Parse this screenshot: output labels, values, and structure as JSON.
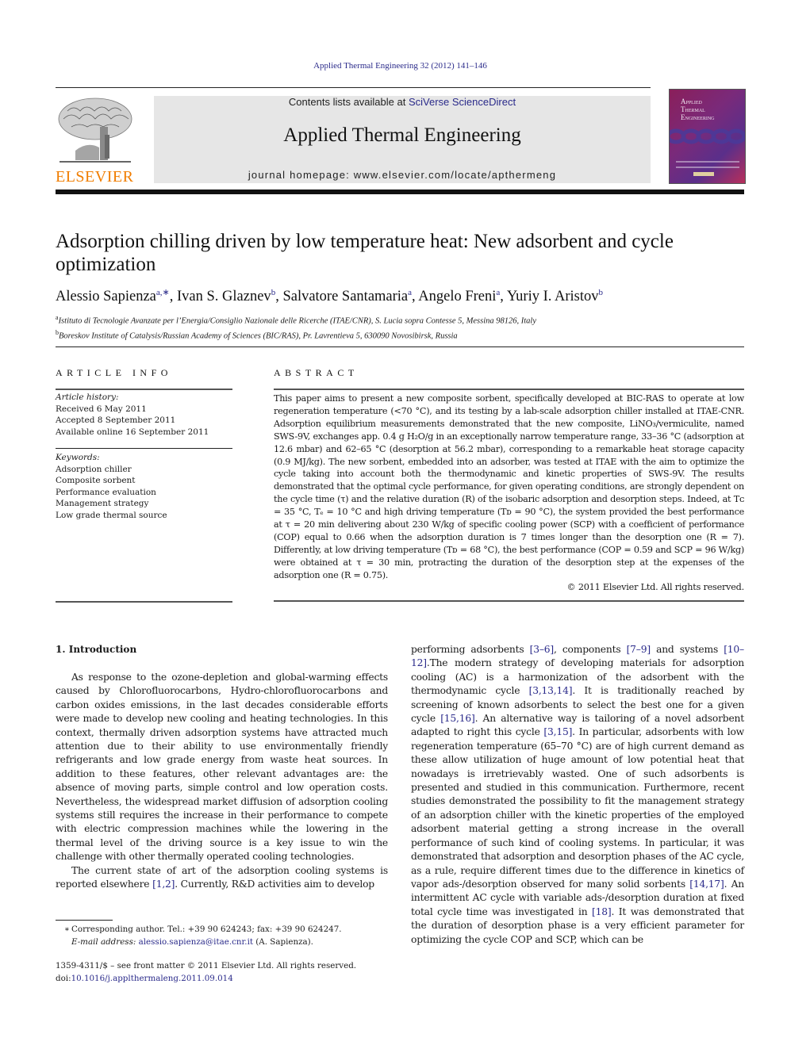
{
  "journal_ref": "Applied Thermal Engineering 32 (2012) 141–146",
  "header": {
    "contents_prefix": "Contents lists available at ",
    "contents_link": "SciVerse ScienceDirect",
    "journal_title": "Applied Thermal Engineering",
    "homepage": "journal homepage: www.elsevier.com/locate/apthermeng",
    "publisher_logo_text": "ELSEVIER",
    "cover_title_lines": [
      "Applied",
      "Thermal",
      "Engineering"
    ]
  },
  "colors": {
    "link": "#2a2a8a",
    "elsevier_orange": "#f07d00",
    "banner_bg": "#e6e6e6"
  },
  "article": {
    "title": "Adsorption chilling driven by low temperature heat: New adsorbent and cycle optimization",
    "authors": [
      {
        "name": "Alessio Sapienza",
        "sup": "a,∗",
        "sep": ", "
      },
      {
        "name": "Ivan S. Glaznev",
        "sup": "b",
        "sep": ", "
      },
      {
        "name": "Salvatore Santamaria",
        "sup": "a",
        "sep": ", "
      },
      {
        "name": "Angelo Freni",
        "sup": "a",
        "sep": ", "
      },
      {
        "name": "Yuriy I. Aristov",
        "sup": "b",
        "sep": ""
      }
    ],
    "affiliations": [
      {
        "key": "a",
        "text": "Istituto di Tecnologie Avanzate per l’Energia/Consiglio Nazionale delle Ricerche (ITAE/CNR), S. Lucia sopra Contesse 5, Messina 98126, Italy"
      },
      {
        "key": "b",
        "text": "Boreskov Institute of Catalysis/Russian Academy of Sciences (BIC/RAS), Pr. Lavrentieva 5, 630090 Novosibirsk, Russia"
      }
    ]
  },
  "article_info": {
    "heading": "ARTICLE INFO",
    "history_label": "Article history:",
    "history": [
      "Received 6 May 2011",
      "Accepted 8 September 2011",
      "Available online 16 September 2011"
    ],
    "keywords_label": "Keywords:",
    "keywords": [
      "Adsorption chiller",
      "Composite sorbent",
      "Performance evaluation",
      "Management strategy",
      "Low grade thermal source"
    ]
  },
  "abstract": {
    "heading": "ABSTRACT",
    "text": "This paper aims to present a new composite sorbent, specifically developed at BIC-RAS to operate at low regeneration temperature (<70 °C), and its testing by a lab-scale adsorption chiller installed at ITAE-CNR. Adsorption equilibrium measurements demonstrated that the new composite, LiNO₃/vermiculite, named SWS-9V, exchanges app. 0.4 g H₂O/g in an exceptionally narrow temperature range, 33–36 °C (adsorption at 12.6 mbar) and 62–65 °C (desorption at 56.2 mbar), corresponding to a remarkable heat storage capacity (0.9 MJ/kg). The new sorbent, embedded into an adsorber, was tested at ITAE with the aim to optimize the cycle taking into account both the thermodynamic and kinetic properties of SWS-9V. The results demonstrated that the optimal cycle performance, for given operating conditions, are strongly dependent on the cycle time (τ) and the relative duration (R) of the isobaric adsorption and desorption steps. Indeed, at Tᴄ = 35 °C, Tₑ = 10 °C and high driving temperature (Tᴅ = 90 °C), the system provided the best performance at τ = 20 min delivering about 230 W/kg of specific cooling power (SCP) with a coefficient of performance (COP) equal to 0.66 when the adsorption duration is 7 times longer than the desorption one (R = 7). Differently, at low driving temperature (Tᴅ = 68 °C), the best performance (COP = 0.59 and SCP = 96 W/kg) were obtained at τ = 30 min, protracting the duration of the desorption step at the expenses of the adsorption one (R = 0.75).",
    "copyright": "© 2011 Elsevier Ltd. All rights reserved."
  },
  "introduction": {
    "heading": "1.  Introduction",
    "left_paragraphs": [
      "As response to the ozone-depletion and global-warming effects caused by Chlorofluorocarbons, Hydro-chlorofluorocarbons and carbon oxides emissions, in the last decades considerable efforts were made to develop new cooling and heating technologies. In this context, thermally driven adsorption systems have attracted much attention due to their ability to use environmentally friendly refrigerants and low grade energy from waste heat sources. In addition to these features, other relevant advantages are: the absence of moving parts, simple control and low operation costs. Nevertheless, the widespread market diffusion of adsorption cooling systems still requires the increase in their performance to compete with electric compression machines while the lowering in the thermal level of the driving source is a key issue to win the challenge with other thermally operated cooling technologies.",
      "The current state of art of the adsorption cooling systems is reported elsewhere [1,2]. Currently, R&D activities aim to develop"
    ],
    "right_paragraph": "performing adsorbents [3–6], components [7–9] and systems [10–12].The modern strategy of developing materials for adsorption cooling (AC) is a harmonization of the adsorbent with the thermodynamic cycle [3,13,14]. It is traditionally reached by screening of known adsorbents to select the best one for a given cycle [15,16]. An alternative way is tailoring of a novel adsorbent adapted to right this cycle [3,15]. In particular, adsorbents with low regeneration temperature (65–70 °C) are of high current demand as these allow utilization of huge amount of low potential heat that nowadays is irretrievably wasted. One of such adsorbents is presented and studied in this communication. Furthermore, recent studies demonstrated the possibility to fit the management strategy of an adsorption chiller with the kinetic properties of the employed adsorbent material getting a strong increase in the overall performance of such kind of cooling systems. In particular, it was demonstrated that adsorption and desorption phases of the AC cycle, as a rule, require different times due to the difference in kinetics of vapor ads-/desorption observed for many solid sorbents [14,17]. An intermittent AC cycle with variable ads-/desorption duration at fixed total cycle time was investigated in [18]. It was demonstrated that the duration of desorption phase is a very efficient parameter for optimizing the cycle COP and SCP, which can be"
  },
  "footnote": {
    "star": "∗",
    "corresponding": "Corresponding author. Tel.: +39 90 624243; fax: +39 90 624247.",
    "email_label": "E-mail address:",
    "email": "alessio.sapienza@itae.cnr.it",
    "email_suffix": " (A. Sapienza)."
  },
  "front_matter": {
    "issn_line": "1359-4311/$ – see front matter © 2011 Elsevier Ltd. All rights reserved.",
    "doi_prefix": "doi:",
    "doi": "10.1016/j.applthermaleng.2011.09.014"
  }
}
